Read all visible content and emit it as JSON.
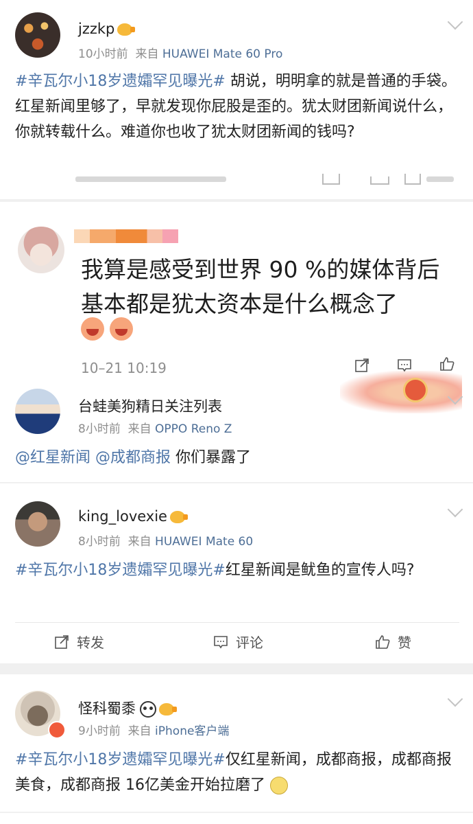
{
  "colors": {
    "link": "#4f76a8",
    "meta": "#8e8e8e",
    "device": "#4d6e96",
    "separator": "#f0f0f0"
  },
  "post1": {
    "user": "jzzkp",
    "time": "10小时前",
    "from": "来自",
    "device": "HUAWEI Mate 60 Pro",
    "hashtag": "#辛瓦尔小18岁遗孀罕见曝光#",
    "text": " 胡说，明明拿的就是普通的手袋。红星新闻里够了，早就发现你屁股是歪的。犹太财团新闻说什么，你就转载什么。难道你也收了犹太财团新闻的钱吗?"
  },
  "quoted": {
    "text": "我算是感受到世界 90 %的媒体背后基本都是犹太资本是什么概念了",
    "time": "10–21 10:19"
  },
  "post2": {
    "user": "台蛙美狗精日关注列表",
    "time": "8小时前",
    "from": "来自",
    "device": "OPPO Reno Z",
    "mention1": "@红星新闻",
    "mention2": "@成都商报",
    "text": " 你们暴露了"
  },
  "post3": {
    "user": "king_lovexie",
    "time": "8小时前",
    "from": "来自",
    "device": "HUAWEI Mate 60",
    "hashtag": "#辛瓦尔小18岁遗孀罕见曝光#",
    "text": "红星新闻是鱿鱼的宣传人吗?",
    "actions": {
      "repost": "转发",
      "comment": "评论",
      "like": "赞"
    }
  },
  "post4": {
    "user": "怪科蜀黍",
    "time": "9小时前",
    "from": "来自",
    "device": "iPhone客户端",
    "hashtag": "#辛瓦尔小18岁遗孀罕见曝光#",
    "text": "仅红星新闻，成都商报，成都商报美食，成都商报 16亿美金开始拉磨了"
  }
}
